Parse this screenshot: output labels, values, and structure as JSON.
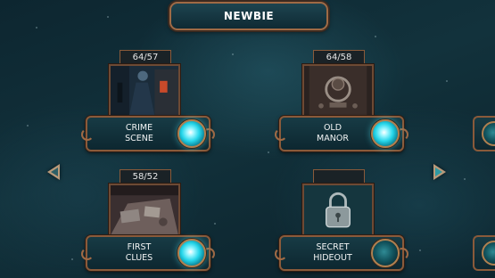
{
  "title": "NEWBIE",
  "levels": [
    {
      "score": "64/57",
      "name_line1": "CRIME",
      "name_line2": "SCENE",
      "orb": "active",
      "thumb": "alley"
    },
    {
      "score": "64/58",
      "name_line1": "OLD",
      "name_line2": "MANOR",
      "orb": "active",
      "thumb": "door-knocker"
    },
    {
      "score": "58/52",
      "name_line1": "FIRST",
      "name_line2": "CLUES",
      "orb": "active",
      "thumb": "table"
    },
    {
      "score": "",
      "name_line1": "SECRET",
      "name_line2": "HIDEOUT",
      "orb": "locked",
      "thumb": "padlock"
    }
  ],
  "icons": {
    "prev": "arrow-left-icon",
    "next": "arrow-right-icon",
    "lock": "padlock-icon"
  },
  "colors": {
    "orb_active": "#26d6ea",
    "frame": "#8a5a3a",
    "background": "#12323c"
  }
}
